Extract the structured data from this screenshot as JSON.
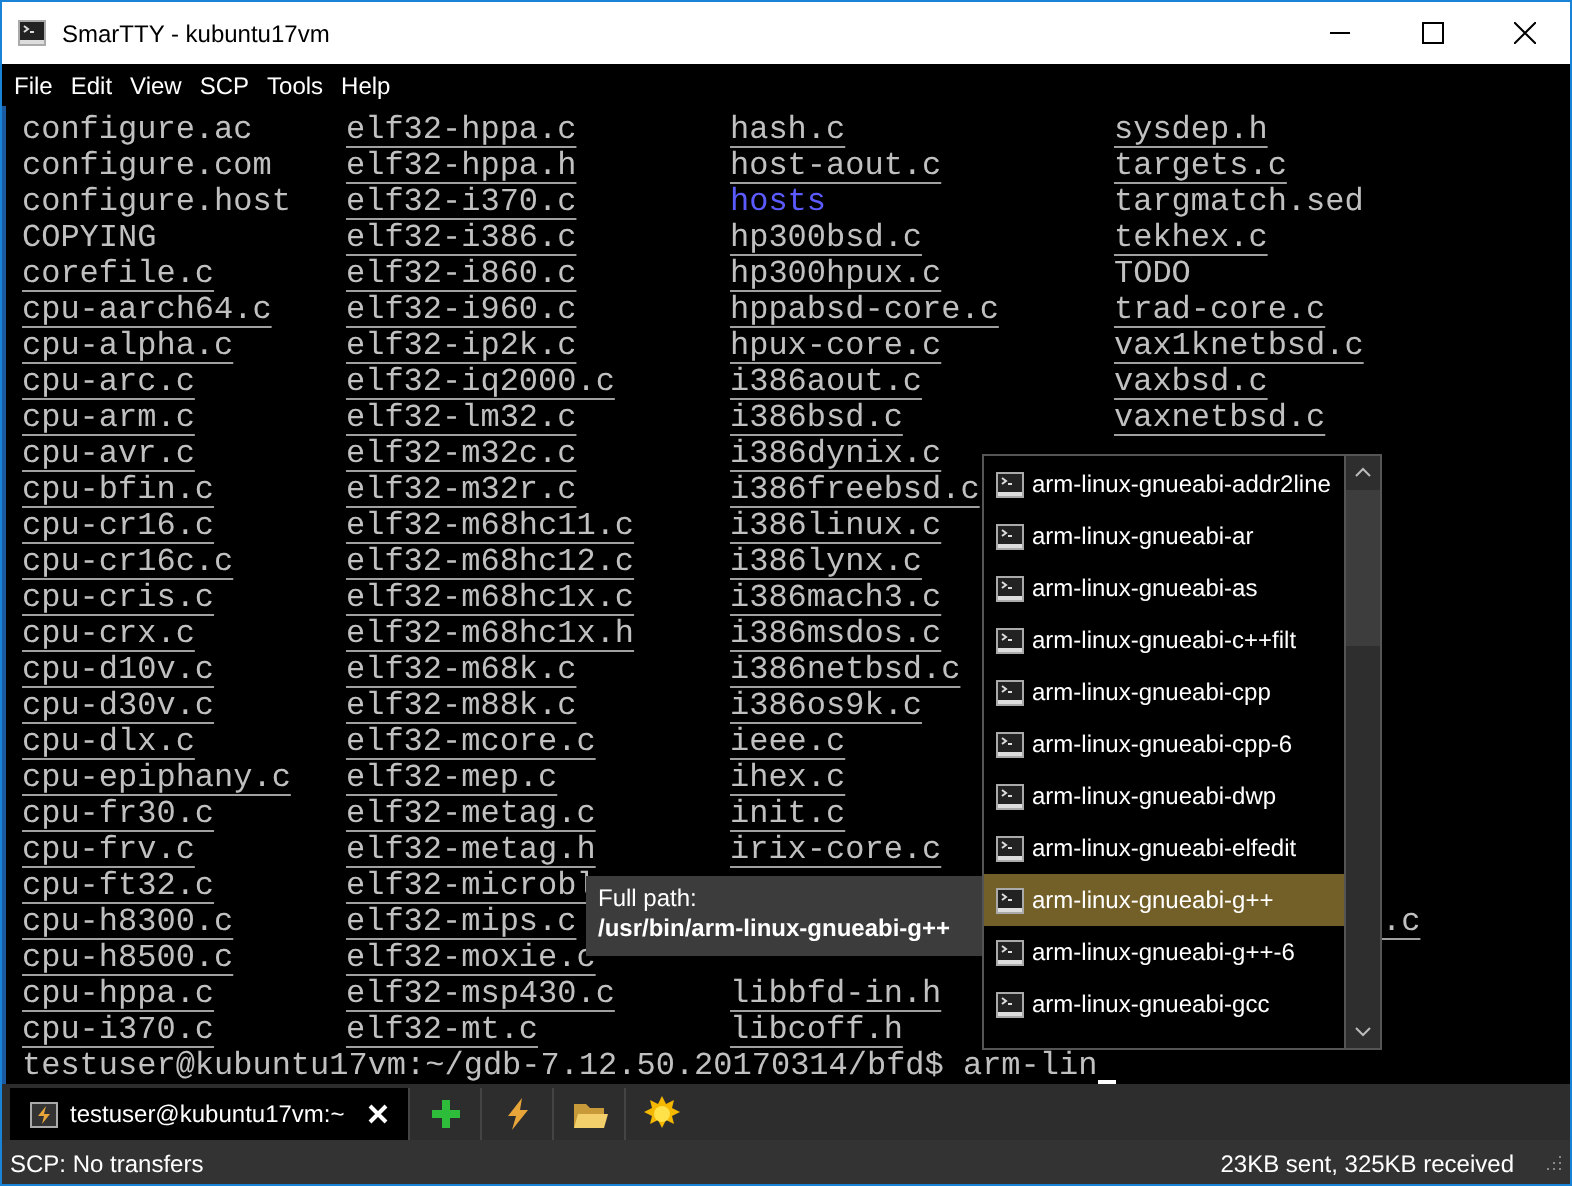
{
  "window": {
    "title": "SmarTTY - kubuntu17vm"
  },
  "menu": [
    "File",
    "Edit",
    "View",
    "SCP",
    "Tools",
    "Help"
  ],
  "terminal": {
    "rows": [
      [
        {
          "text": "configure.ac",
          "kind": "plain"
        },
        {
          "text": "elf32-hppa.c",
          "kind": "file"
        },
        {
          "text": "hash.c",
          "kind": "file"
        },
        {
          "text": "sysdep.h",
          "kind": "file"
        }
      ],
      [
        {
          "text": "configure.com",
          "kind": "plain"
        },
        {
          "text": "elf32-hppa.h",
          "kind": "file"
        },
        {
          "text": "host-aout.c",
          "kind": "file"
        },
        {
          "text": "targets.c",
          "kind": "file"
        }
      ],
      [
        {
          "text": "configure.host",
          "kind": "plain"
        },
        {
          "text": "elf32-i370.c",
          "kind": "file"
        },
        {
          "text": "hosts",
          "kind": "dir"
        },
        {
          "text": "targmatch.sed",
          "kind": "plain"
        }
      ],
      [
        {
          "text": "COPYING",
          "kind": "plain"
        },
        {
          "text": "elf32-i386.c",
          "kind": "file"
        },
        {
          "text": "hp300bsd.c",
          "kind": "file"
        },
        {
          "text": "tekhex.c",
          "kind": "file"
        }
      ],
      [
        {
          "text": "corefile.c",
          "kind": "file"
        },
        {
          "text": "elf32-i860.c",
          "kind": "file"
        },
        {
          "text": "hp300hpux.c",
          "kind": "file"
        },
        {
          "text": "TODO",
          "kind": "plain"
        }
      ],
      [
        {
          "text": "cpu-aarch64.c",
          "kind": "file"
        },
        {
          "text": "elf32-i960.c",
          "kind": "file"
        },
        {
          "text": "hppabsd-core.c",
          "kind": "file"
        },
        {
          "text": "trad-core.c",
          "kind": "file"
        }
      ],
      [
        {
          "text": "cpu-alpha.c",
          "kind": "file"
        },
        {
          "text": "elf32-ip2k.c",
          "kind": "file"
        },
        {
          "text": "hpux-core.c",
          "kind": "file"
        },
        {
          "text": "vax1knetbsd.c",
          "kind": "file"
        }
      ],
      [
        {
          "text": "cpu-arc.c",
          "kind": "file"
        },
        {
          "text": "elf32-iq2000.c",
          "kind": "file"
        },
        {
          "text": "i386aout.c",
          "kind": "file"
        },
        {
          "text": "vaxbsd.c",
          "kind": "file"
        }
      ],
      [
        {
          "text": "cpu-arm.c",
          "kind": "file"
        },
        {
          "text": "elf32-lm32.c",
          "kind": "file"
        },
        {
          "text": "i386bsd.c",
          "kind": "file"
        },
        {
          "text": "vaxnetbsd.c",
          "kind": "file"
        }
      ],
      [
        {
          "text": "cpu-avr.c",
          "kind": "file"
        },
        {
          "text": "elf32-m32c.c",
          "kind": "file"
        },
        {
          "text": "i386dynix.c",
          "kind": "file"
        }
      ],
      [
        {
          "text": "cpu-bfin.c",
          "kind": "file"
        },
        {
          "text": "elf32-m32r.c",
          "kind": "file"
        },
        {
          "text": "i386freebsd.c",
          "kind": "file"
        }
      ],
      [
        {
          "text": "cpu-cr16.c",
          "kind": "file"
        },
        {
          "text": "elf32-m68hc11.c",
          "kind": "file"
        },
        {
          "text": "i386linux.c",
          "kind": "file"
        }
      ],
      [
        {
          "text": "cpu-cr16c.c",
          "kind": "file"
        },
        {
          "text": "elf32-m68hc12.c",
          "kind": "file"
        },
        {
          "text": "i386lynx.c",
          "kind": "file"
        }
      ],
      [
        {
          "text": "cpu-cris.c",
          "kind": "file"
        },
        {
          "text": "elf32-m68hc1x.c",
          "kind": "file"
        },
        {
          "text": "i386mach3.c",
          "kind": "file"
        }
      ],
      [
        {
          "text": "cpu-crx.c",
          "kind": "file"
        },
        {
          "text": "elf32-m68hc1x.h",
          "kind": "file"
        },
        {
          "text": "i386msdos.c",
          "kind": "file"
        }
      ],
      [
        {
          "text": "cpu-d10v.c",
          "kind": "file"
        },
        {
          "text": "elf32-m68k.c",
          "kind": "file"
        },
        {
          "text": "i386netbsd.c",
          "kind": "file"
        }
      ],
      [
        {
          "text": "cpu-d30v.c",
          "kind": "file"
        },
        {
          "text": "elf32-m88k.c",
          "kind": "file"
        },
        {
          "text": "i386os9k.c",
          "kind": "file"
        }
      ],
      [
        {
          "text": "cpu-dlx.c",
          "kind": "file"
        },
        {
          "text": "elf32-mcore.c",
          "kind": "file"
        },
        {
          "text": "ieee.c",
          "kind": "file"
        }
      ],
      [
        {
          "text": "cpu-epiphany.c",
          "kind": "file"
        },
        {
          "text": "elf32-mep.c",
          "kind": "file"
        },
        {
          "text": "ihex.c",
          "kind": "file"
        }
      ],
      [
        {
          "text": "cpu-fr30.c",
          "kind": "file"
        },
        {
          "text": "elf32-metag.c",
          "kind": "file"
        },
        {
          "text": "init.c",
          "kind": "file"
        }
      ],
      [
        {
          "text": "cpu-frv.c",
          "kind": "file"
        },
        {
          "text": "elf32-metag.h",
          "kind": "file"
        },
        {
          "text": "irix-core.c",
          "kind": "file"
        }
      ],
      [
        {
          "text": "cpu-ft32.c",
          "kind": "file"
        },
        {
          "text": "elf32-microbl",
          "kind": "file"
        }
      ],
      [
        {
          "text": "cpu-h8300.c",
          "kind": "file"
        },
        {
          "text": "elf32-mips.c",
          "kind": "file"
        },
        null,
        {
          "text": ".c",
          "kind": "tail"
        }
      ],
      [
        {
          "text": "cpu-h8500.c",
          "kind": "file"
        },
        {
          "text": "elf32-moxie.c",
          "kind": "file"
        }
      ],
      [
        {
          "text": "cpu-hppa.c",
          "kind": "file"
        },
        {
          "text": "elf32-msp430.c",
          "kind": "file"
        },
        {
          "text": "libbfd-in.h",
          "kind": "file"
        }
      ],
      [
        {
          "text": "cpu-i370.c",
          "kind": "file"
        },
        {
          "text": "elf32-mt.c",
          "kind": "file"
        },
        {
          "text": "libcoff.h",
          "kind": "file"
        }
      ]
    ],
    "prompt": "testuser@kubuntu17vm:~/gdb-7.12.50.20170314/bfd$ arm-lin"
  },
  "completion": {
    "items": [
      {
        "label": "arm-linux-gnueabi-addr2line",
        "selected": false
      },
      {
        "label": "arm-linux-gnueabi-ar",
        "selected": false
      },
      {
        "label": "arm-linux-gnueabi-as",
        "selected": false
      },
      {
        "label": "arm-linux-gnueabi-c++filt",
        "selected": false
      },
      {
        "label": "arm-linux-gnueabi-cpp",
        "selected": false
      },
      {
        "label": "arm-linux-gnueabi-cpp-6",
        "selected": false
      },
      {
        "label": "arm-linux-gnueabi-dwp",
        "selected": false
      },
      {
        "label": "arm-linux-gnueabi-elfedit",
        "selected": false
      },
      {
        "label": "arm-linux-gnueabi-g++",
        "selected": true
      },
      {
        "label": "arm-linux-gnueabi-g++-6",
        "selected": false
      },
      {
        "label": "arm-linux-gnueabi-gcc",
        "selected": false
      }
    ]
  },
  "tooltip": {
    "label": "Full path:",
    "path": "/usr/bin/arm-linux-gnueabi-g++"
  },
  "tabs": [
    {
      "label": "testuser@kubuntu17vm:~",
      "selected": true
    }
  ],
  "toolbar": [
    {
      "kind": "new"
    },
    {
      "kind": "bolt"
    },
    {
      "kind": "folder"
    },
    {
      "kind": "sun"
    }
  ],
  "status_bar": {
    "left": "SCP: No transfers",
    "right": "23KB sent, 325KB received"
  }
}
